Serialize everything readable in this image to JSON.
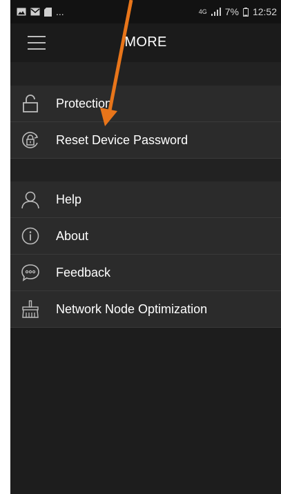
{
  "status_bar": {
    "left_icons": [
      "image-icon",
      "mail-icon",
      "sd-card-icon"
    ],
    "ellipsis": "...",
    "network_type": "4G",
    "battery_percent": "7%",
    "time": "12:52"
  },
  "header": {
    "title": "MORE",
    "menu_icon": "hamburger-icon"
  },
  "section1": [
    {
      "label": "Protection",
      "icon": "lock-icon"
    },
    {
      "label": "Reset Device Password",
      "icon": "reset-lock-icon"
    }
  ],
  "section2": [
    {
      "label": "Help",
      "icon": "person-icon"
    },
    {
      "label": "About",
      "icon": "info-icon"
    },
    {
      "label": "Feedback",
      "icon": "chat-bubble-icon"
    },
    {
      "label": "Network Node Optimization",
      "icon": "broom-icon"
    }
  ],
  "colors": {
    "background": "#1d1d1d",
    "list_item": "#2b2b2b",
    "text": "#ffffff",
    "annotation_arrow": "#e8751a"
  }
}
